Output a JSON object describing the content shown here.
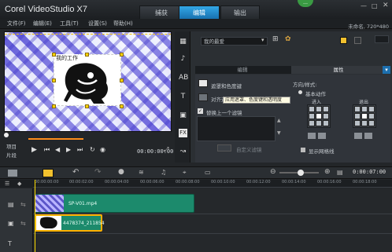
{
  "app": {
    "title": "Corel VideoStudio X7"
  },
  "tabs": [
    {
      "label": "捕获"
    },
    {
      "label": "编辑"
    },
    {
      "label": "输出"
    }
  ],
  "project": {
    "info": "未命名, 720*480"
  },
  "menu": [
    "文件(F)",
    "编辑(E)",
    "工具(T)",
    "设置(S)",
    "帮助(H)"
  ],
  "preview": {
    "overlay_text": "我的工作"
  },
  "playback": {
    "mode_labels": [
      "项目",
      "片段"
    ],
    "timecode": "00:00:00:00"
  },
  "effects": {
    "category": "我的最爱"
  },
  "panel_tabs": [
    {
      "label": "编辑"
    },
    {
      "label": "属性"
    }
  ],
  "attributes": {
    "mask_chroma": "遮罩和色度键",
    "align": "对齐选项",
    "tooltip": "应用遮罩、色度键和透明度",
    "replace_last": "替换上一个滤镜",
    "direction_label": "方向/样式:",
    "basic_motion": "基本动作",
    "enter_label": "进入",
    "exit_label": "退出",
    "custom_filter": "自定义滤镜",
    "show_grid": "显示网格线"
  },
  "timeline": {
    "timecode": "0:00:07:00",
    "ruler_ticks": [
      "00:00:00:00",
      "00:00:02:00",
      "00:00:04:00",
      "00:00:06:00",
      "00:00:08:00",
      "00:00:10:00",
      "00:00:12:00",
      "00:00:14:00",
      "00:00:16:00",
      "00:00:18:00"
    ],
    "clips": [
      {
        "name": "SP-V01.mp4"
      },
      {
        "name": "4478374_211854"
      }
    ]
  },
  "colors": {
    "accent": "#1e88c8",
    "clip": "#1c8a6c",
    "selection": "#ffb000"
  }
}
